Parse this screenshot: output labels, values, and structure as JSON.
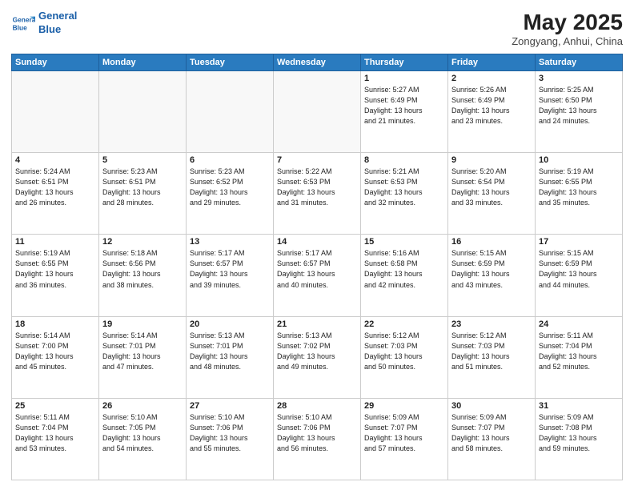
{
  "header": {
    "logo_line1": "General",
    "logo_line2": "Blue",
    "month_year": "May 2025",
    "location": "Zongyang, Anhui, China"
  },
  "days_of_week": [
    "Sunday",
    "Monday",
    "Tuesday",
    "Wednesday",
    "Thursday",
    "Friday",
    "Saturday"
  ],
  "weeks": [
    [
      {
        "day": "",
        "info": ""
      },
      {
        "day": "",
        "info": ""
      },
      {
        "day": "",
        "info": ""
      },
      {
        "day": "",
        "info": ""
      },
      {
        "day": "1",
        "info": "Sunrise: 5:27 AM\nSunset: 6:49 PM\nDaylight: 13 hours\nand 21 minutes."
      },
      {
        "day": "2",
        "info": "Sunrise: 5:26 AM\nSunset: 6:49 PM\nDaylight: 13 hours\nand 23 minutes."
      },
      {
        "day": "3",
        "info": "Sunrise: 5:25 AM\nSunset: 6:50 PM\nDaylight: 13 hours\nand 24 minutes."
      }
    ],
    [
      {
        "day": "4",
        "info": "Sunrise: 5:24 AM\nSunset: 6:51 PM\nDaylight: 13 hours\nand 26 minutes."
      },
      {
        "day": "5",
        "info": "Sunrise: 5:23 AM\nSunset: 6:51 PM\nDaylight: 13 hours\nand 28 minutes."
      },
      {
        "day": "6",
        "info": "Sunrise: 5:23 AM\nSunset: 6:52 PM\nDaylight: 13 hours\nand 29 minutes."
      },
      {
        "day": "7",
        "info": "Sunrise: 5:22 AM\nSunset: 6:53 PM\nDaylight: 13 hours\nand 31 minutes."
      },
      {
        "day": "8",
        "info": "Sunrise: 5:21 AM\nSunset: 6:53 PM\nDaylight: 13 hours\nand 32 minutes."
      },
      {
        "day": "9",
        "info": "Sunrise: 5:20 AM\nSunset: 6:54 PM\nDaylight: 13 hours\nand 33 minutes."
      },
      {
        "day": "10",
        "info": "Sunrise: 5:19 AM\nSunset: 6:55 PM\nDaylight: 13 hours\nand 35 minutes."
      }
    ],
    [
      {
        "day": "11",
        "info": "Sunrise: 5:19 AM\nSunset: 6:55 PM\nDaylight: 13 hours\nand 36 minutes."
      },
      {
        "day": "12",
        "info": "Sunrise: 5:18 AM\nSunset: 6:56 PM\nDaylight: 13 hours\nand 38 minutes."
      },
      {
        "day": "13",
        "info": "Sunrise: 5:17 AM\nSunset: 6:57 PM\nDaylight: 13 hours\nand 39 minutes."
      },
      {
        "day": "14",
        "info": "Sunrise: 5:17 AM\nSunset: 6:57 PM\nDaylight: 13 hours\nand 40 minutes."
      },
      {
        "day": "15",
        "info": "Sunrise: 5:16 AM\nSunset: 6:58 PM\nDaylight: 13 hours\nand 42 minutes."
      },
      {
        "day": "16",
        "info": "Sunrise: 5:15 AM\nSunset: 6:59 PM\nDaylight: 13 hours\nand 43 minutes."
      },
      {
        "day": "17",
        "info": "Sunrise: 5:15 AM\nSunset: 6:59 PM\nDaylight: 13 hours\nand 44 minutes."
      }
    ],
    [
      {
        "day": "18",
        "info": "Sunrise: 5:14 AM\nSunset: 7:00 PM\nDaylight: 13 hours\nand 45 minutes."
      },
      {
        "day": "19",
        "info": "Sunrise: 5:14 AM\nSunset: 7:01 PM\nDaylight: 13 hours\nand 47 minutes."
      },
      {
        "day": "20",
        "info": "Sunrise: 5:13 AM\nSunset: 7:01 PM\nDaylight: 13 hours\nand 48 minutes."
      },
      {
        "day": "21",
        "info": "Sunrise: 5:13 AM\nSunset: 7:02 PM\nDaylight: 13 hours\nand 49 minutes."
      },
      {
        "day": "22",
        "info": "Sunrise: 5:12 AM\nSunset: 7:03 PM\nDaylight: 13 hours\nand 50 minutes."
      },
      {
        "day": "23",
        "info": "Sunrise: 5:12 AM\nSunset: 7:03 PM\nDaylight: 13 hours\nand 51 minutes."
      },
      {
        "day": "24",
        "info": "Sunrise: 5:11 AM\nSunset: 7:04 PM\nDaylight: 13 hours\nand 52 minutes."
      }
    ],
    [
      {
        "day": "25",
        "info": "Sunrise: 5:11 AM\nSunset: 7:04 PM\nDaylight: 13 hours\nand 53 minutes."
      },
      {
        "day": "26",
        "info": "Sunrise: 5:10 AM\nSunset: 7:05 PM\nDaylight: 13 hours\nand 54 minutes."
      },
      {
        "day": "27",
        "info": "Sunrise: 5:10 AM\nSunset: 7:06 PM\nDaylight: 13 hours\nand 55 minutes."
      },
      {
        "day": "28",
        "info": "Sunrise: 5:10 AM\nSunset: 7:06 PM\nDaylight: 13 hours\nand 56 minutes."
      },
      {
        "day": "29",
        "info": "Sunrise: 5:09 AM\nSunset: 7:07 PM\nDaylight: 13 hours\nand 57 minutes."
      },
      {
        "day": "30",
        "info": "Sunrise: 5:09 AM\nSunset: 7:07 PM\nDaylight: 13 hours\nand 58 minutes."
      },
      {
        "day": "31",
        "info": "Sunrise: 5:09 AM\nSunset: 7:08 PM\nDaylight: 13 hours\nand 59 minutes."
      }
    ]
  ]
}
